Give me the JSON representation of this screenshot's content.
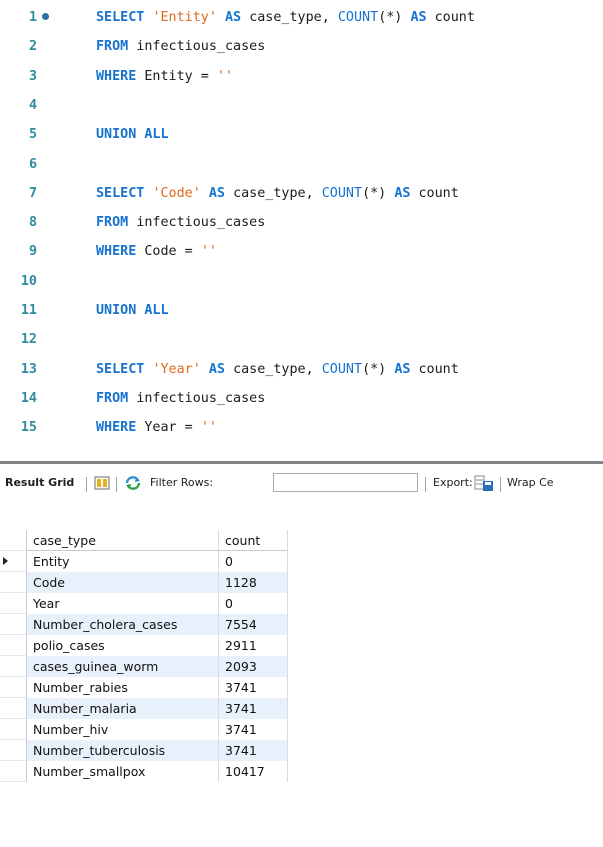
{
  "editor": {
    "lines": [
      {
        "num": "1",
        "tokens": [
          [
            "kw",
            "SELECT "
          ],
          [
            "str",
            "'Entity'"
          ],
          [
            "kw",
            " AS "
          ],
          [
            "pl",
            "case_type, "
          ],
          [
            "fn",
            "COUNT"
          ],
          [
            "pl",
            "(*) "
          ],
          [
            "kw",
            "AS "
          ],
          [
            "pl",
            "count"
          ]
        ],
        "breakpoint": true
      },
      {
        "num": "2",
        "tokens": [
          [
            "kw",
            "FROM "
          ],
          [
            "pl",
            "infectious_cases"
          ]
        ]
      },
      {
        "num": "3",
        "tokens": [
          [
            "kw",
            "WHERE "
          ],
          [
            "pl",
            "Entity = "
          ],
          [
            "str",
            "''"
          ]
        ]
      },
      {
        "num": "4",
        "tokens": []
      },
      {
        "num": "5",
        "tokens": [
          [
            "kw",
            "UNION ALL"
          ]
        ]
      },
      {
        "num": "6",
        "tokens": []
      },
      {
        "num": "7",
        "tokens": [
          [
            "kw",
            "SELECT "
          ],
          [
            "str",
            "'Code'"
          ],
          [
            "kw",
            " AS "
          ],
          [
            "pl",
            "case_type, "
          ],
          [
            "fn",
            "COUNT"
          ],
          [
            "pl",
            "(*) "
          ],
          [
            "kw",
            "AS "
          ],
          [
            "pl",
            "count"
          ]
        ]
      },
      {
        "num": "8",
        "tokens": [
          [
            "kw",
            "FROM "
          ],
          [
            "pl",
            "infectious_cases"
          ]
        ]
      },
      {
        "num": "9",
        "tokens": [
          [
            "kw",
            "WHERE "
          ],
          [
            "pl",
            "Code = "
          ],
          [
            "str",
            "''"
          ]
        ]
      },
      {
        "num": "10",
        "tokens": []
      },
      {
        "num": "11",
        "tokens": [
          [
            "kw",
            "UNION ALL"
          ]
        ]
      },
      {
        "num": "12",
        "tokens": []
      },
      {
        "num": "13",
        "tokens": [
          [
            "kw",
            "SELECT "
          ],
          [
            "str",
            "'Year'"
          ],
          [
            "kw",
            " AS "
          ],
          [
            "pl",
            "case_type, "
          ],
          [
            "fn",
            "COUNT"
          ],
          [
            "pl",
            "(*) "
          ],
          [
            "kw",
            "AS "
          ],
          [
            "pl",
            "count"
          ]
        ]
      },
      {
        "num": "14",
        "tokens": [
          [
            "kw",
            "FROM "
          ],
          [
            "pl",
            "infectious_cases"
          ]
        ]
      },
      {
        "num": "15",
        "tokens": [
          [
            "kw",
            "WHERE "
          ],
          [
            "pl",
            "Year = "
          ],
          [
            "str",
            "''"
          ]
        ]
      }
    ]
  },
  "toolbar": {
    "result_grid_label": "Result Grid",
    "filter_rows_label": "Filter Rows:",
    "filter_value": "",
    "export_label": "Export:",
    "wrap_label": "Wrap Ce"
  },
  "grid": {
    "columns": [
      "case_type",
      "count"
    ],
    "rows": [
      [
        "Entity",
        "0"
      ],
      [
        "Code",
        "1128"
      ],
      [
        "Year",
        "0"
      ],
      [
        "Number_cholera_cases",
        "7554"
      ],
      [
        "polio_cases",
        "2911"
      ],
      [
        "cases_guinea_worm",
        "2093"
      ],
      [
        "Number_rabies",
        "3741"
      ],
      [
        "Number_malaria",
        "3741"
      ],
      [
        "Number_hiv",
        "3741"
      ],
      [
        "Number_tuberculosis",
        "3741"
      ],
      [
        "Number_smallpox",
        "10417"
      ]
    ]
  }
}
